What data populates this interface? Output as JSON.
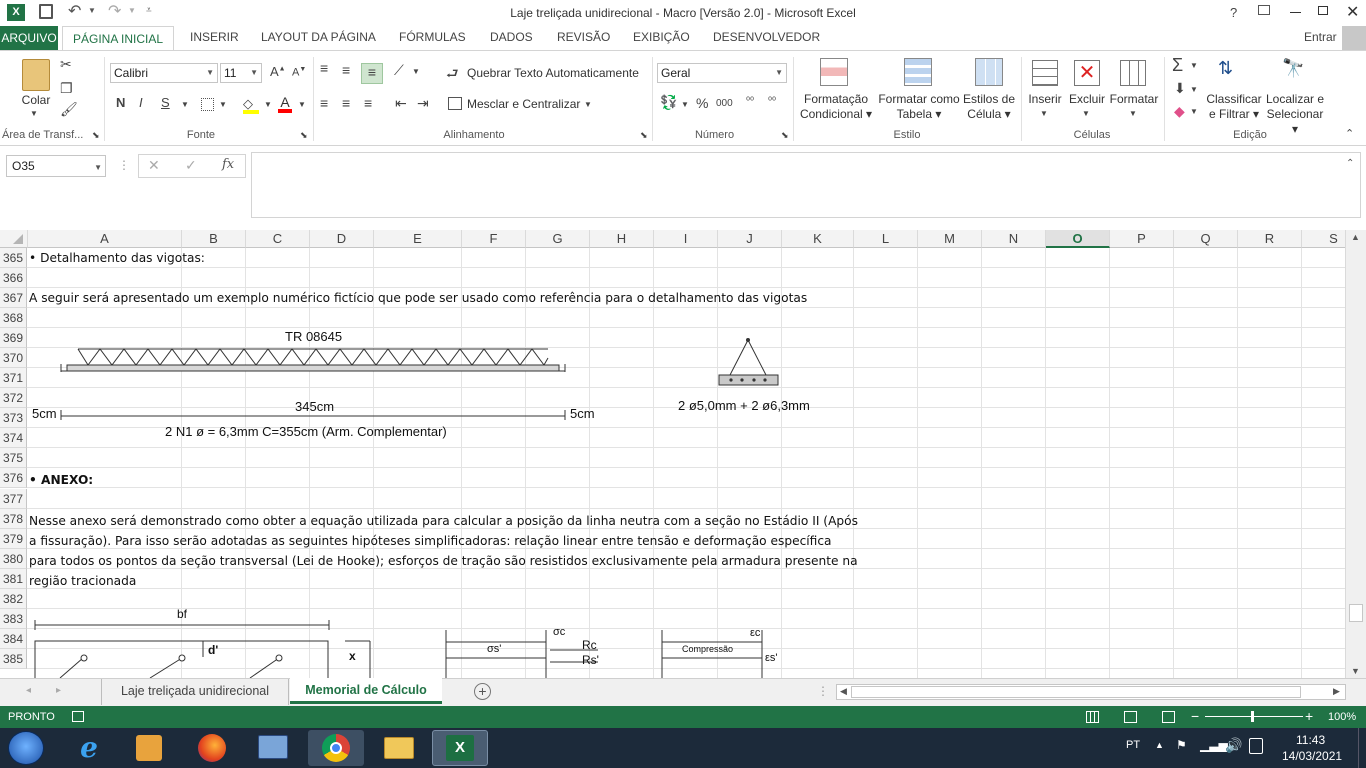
{
  "window": {
    "title": "Laje treliçada unidirecional - Macro [Versão 2.0] - Microsoft Excel",
    "help": "?",
    "user": "Entrar"
  },
  "tabs": [
    "ARQUIVO",
    "PÁGINA INICIAL",
    "INSERIR",
    "LAYOUT DA PÁGINA",
    "FÓRMULAS",
    "DADOS",
    "REVISÃO",
    "EXIBIÇÃO",
    "DESENVOLVEDOR"
  ],
  "ribbon": {
    "clipboard": {
      "paste": "Colar",
      "label": "Área de Transf..."
    },
    "font": {
      "name": "Calibri",
      "size": "11",
      "bold": "N",
      "italic": "I",
      "underline": "S",
      "label": "Fonte"
    },
    "alignment": {
      "wrap": "Quebrar Texto Automaticamente",
      "merge": "Mesclar e Centralizar",
      "label": "Alinhamento"
    },
    "number": {
      "format": "Geral",
      "percent": "%",
      "thousands": "000",
      "label": "Número"
    },
    "styles": {
      "cond1": "Formatação",
      "cond2": "Condicional",
      "table1": "Formatar como",
      "table2": "Tabela",
      "cell1": "Estilos de",
      "cell2": "Célula",
      "label": "Estilo"
    },
    "cells": {
      "insert": "Inserir",
      "delete": "Excluir",
      "format": "Formatar",
      "label": "Células"
    },
    "editing": {
      "sort1": "Classificar",
      "sort2": "e Filtrar",
      "find1": "Localizar e",
      "find2": "Selecionar",
      "label": "Edição"
    }
  },
  "formula_bar": {
    "name_box": "O35",
    "fx": "fx",
    "content": ""
  },
  "columns": [
    "A",
    "B",
    "C",
    "D",
    "E",
    "F",
    "G",
    "H",
    "I",
    "J",
    "K",
    "L",
    "M",
    "N",
    "O",
    "P",
    "Q",
    "R",
    "S"
  ],
  "active_column": "O",
  "rows": [
    "365",
    "366",
    "367",
    "368",
    "369",
    "370",
    "371",
    "372",
    "373",
    "374",
    "375",
    "376",
    "377",
    "378",
    "379",
    "380",
    "381",
    "382",
    "383",
    "384",
    "385"
  ],
  "cells": {
    "r365": "• Detalhamento das vigotas:",
    "r367": "A seguir será apresentado um exemplo numérico fictício que pode ser usado como referência para o detalhamento das vigotas",
    "r376": "• ANEXO:",
    "r378": "Nesse anexo será demonstrado como obter a equação utilizada para calcular a posição da linha neutra com a seção no Estádio II (Após",
    "r379": "a fissuração). Para isso serão adotadas as seguintes hipóteses simplificadoras: relação linear entre tensão e deformação específica",
    "r380": "para todos os pontos da seção transversal (Lei de Hooke); esforços de tração são resistidos exclusivamente pela armadura presente na",
    "r381": "região tracionada"
  },
  "drawings": {
    "truss_label": "TR 08645",
    "left_dim": "5cm",
    "mid_dim": "345cm",
    "right_dim": "5cm",
    "bar_note": "2 N1 ø = 6,3mm C=355cm (Arm. Complementar)",
    "section_note": "2 ø5,0mm + 2 ø6,3mm",
    "bf": "bf",
    "dprime": "d'",
    "x": "x",
    "sigma_c": "σc",
    "sigma_s": "σs'",
    "rc": "Rc",
    "rs": "Rs'",
    "eps_c": "εc",
    "compressao": "Compressão",
    "eps_s": "εs'"
  },
  "sheet_tabs": [
    "Laje treliçada unidirecional",
    "Memorial de Cálculo"
  ],
  "active_sheet": "Memorial de Cálculo",
  "status": {
    "mode": "PRONTO",
    "zoom": "100%"
  },
  "taskbar": {
    "lang": "PT",
    "time": "11:43",
    "date": "14/03/2021"
  }
}
